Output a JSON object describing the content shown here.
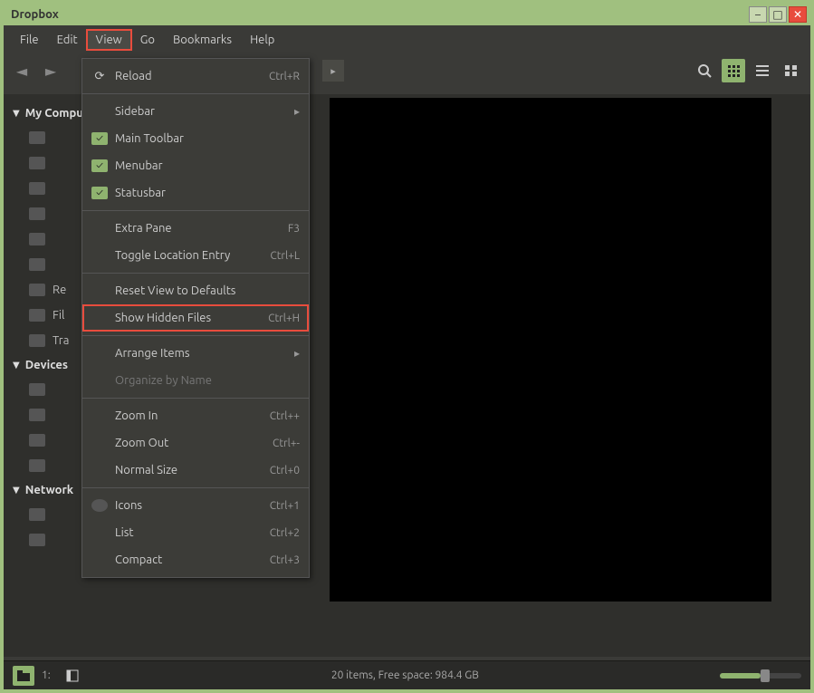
{
  "window": {
    "title": "Dropbox"
  },
  "menubar": {
    "items": [
      "File",
      "Edit",
      "View",
      "Go",
      "Bookmarks",
      "Help"
    ],
    "active_index": 2
  },
  "sidebar": {
    "sections": [
      {
        "label": "My Computer",
        "items": [
          "",
          "",
          "",
          "",
          "",
          "",
          "Re",
          "Fil",
          "Tra"
        ]
      },
      {
        "label": "Devices",
        "items": [
          "",
          "",
          "",
          ""
        ]
      },
      {
        "label": "Network",
        "items": [
          "",
          ""
        ]
      }
    ]
  },
  "view_menu": {
    "reload": {
      "label": "Reload",
      "accel": "Ctrl+R"
    },
    "sidebar": {
      "label": "Sidebar"
    },
    "main_toolbar": {
      "label": "Main Toolbar",
      "checked": true
    },
    "menubar": {
      "label": "Menubar",
      "checked": true
    },
    "statusbar": {
      "label": "Statusbar",
      "checked": true
    },
    "extra_pane": {
      "label": "Extra Pane",
      "accel": "F3"
    },
    "toggle_location": {
      "label": "Toggle Location Entry",
      "accel": "Ctrl+L"
    },
    "reset_view": {
      "label": "Reset View to Defaults"
    },
    "show_hidden": {
      "label": "Show Hidden Files",
      "accel": "Ctrl+H"
    },
    "arrange_items": {
      "label": "Arrange Items"
    },
    "organize_by_name": {
      "label": "Organize by Name"
    },
    "zoom_in": {
      "label": "Zoom In",
      "accel": "Ctrl++"
    },
    "zoom_out": {
      "label": "Zoom Out",
      "accel": "Ctrl+-"
    },
    "normal_size": {
      "label": "Normal Size",
      "accel": "Ctrl+0"
    },
    "icons": {
      "label": "Icons",
      "accel": "Ctrl+1"
    },
    "list": {
      "label": "List",
      "accel": "Ctrl+2"
    },
    "compact": {
      "label": "Compact",
      "accel": "Ctrl+3"
    }
  },
  "statusbar": {
    "text": "20 items, Free space: 984.4 GB",
    "path_label": "1:"
  }
}
